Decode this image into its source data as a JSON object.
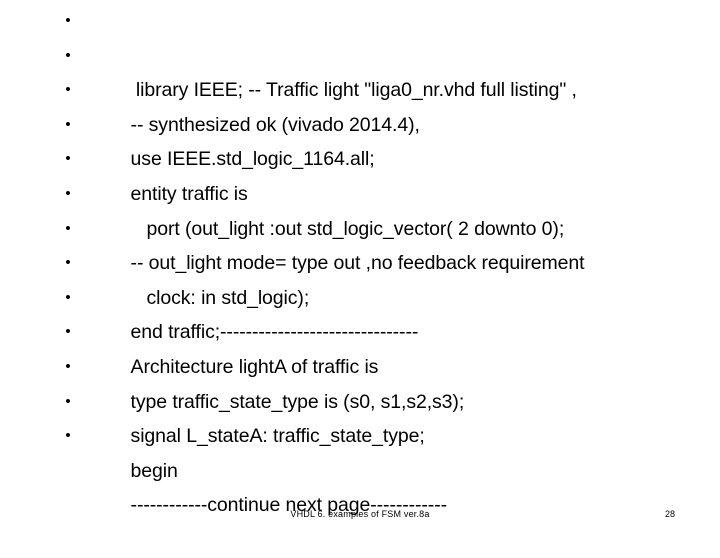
{
  "slide": {
    "background_color": "#ffffff",
    "text_color": "#000000",
    "bullet_glyph": "•",
    "body": {
      "lines": [
        {
          "text": " library IEEE; -- Traffic light \"liga0_nr.vhd full listing\" ,"
        },
        {
          "text": "-- synthesized ok (vivado 2014.4),"
        },
        {
          "text": "use IEEE.std_logic_1164.all;"
        },
        {
          "text": "entity traffic is"
        },
        {
          "text": "   port (out_light :out std_logic_vector( 2 downto 0);"
        },
        {
          "text": "-- out_light mode= type out ,no feedback requirement"
        },
        {
          "text": "   clock: in std_logic);"
        },
        {
          "text": "end traffic;-------------------------------"
        },
        {
          "text": "Architecture lightA of traffic is"
        },
        {
          "text": "type traffic_state_type is (s0, s1,s2,s3);"
        },
        {
          "text": "signal L_stateA: traffic_state_type;"
        },
        {
          "text": "begin"
        },
        {
          "text": "------------continue next page------------"
        }
      ]
    },
    "footer": {
      "title": "VHDL 6. examples of FSM ver.8a",
      "page_number": "28"
    }
  }
}
